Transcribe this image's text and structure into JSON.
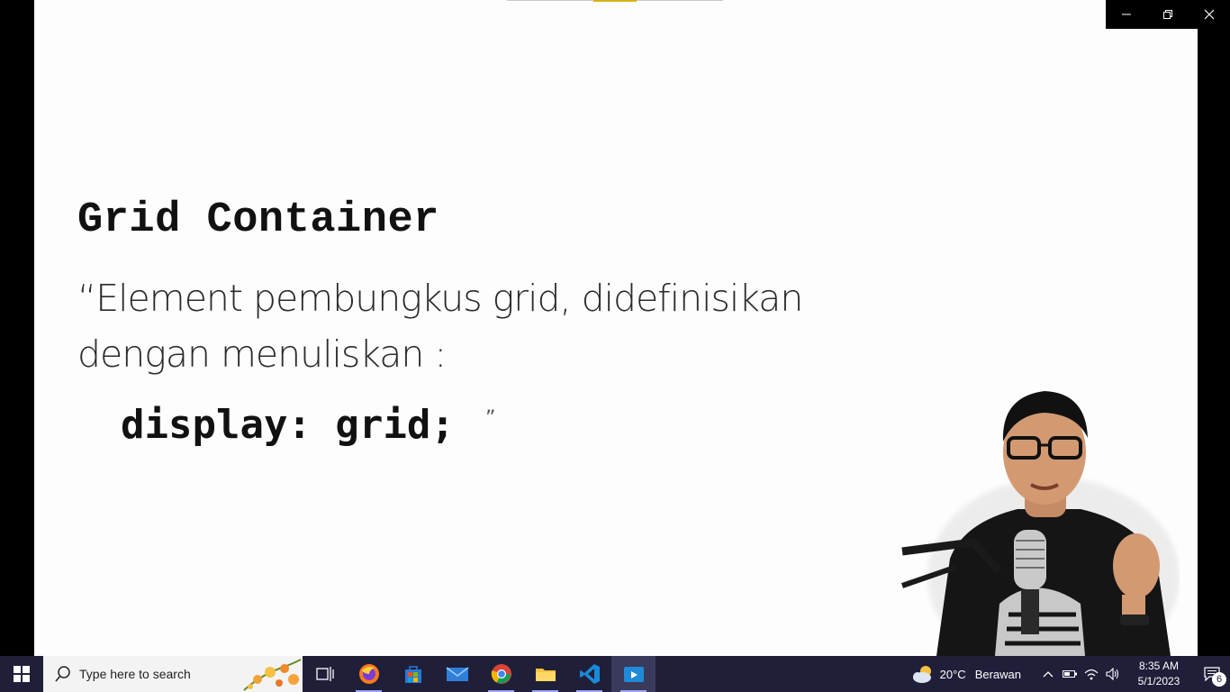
{
  "slide": {
    "title": "Grid Container",
    "quote_line1": "“Element pembungkus grid, didefinisikan",
    "quote_line2": "dengan menuliskan :",
    "code": "display: grid;",
    "close_quote": "”"
  },
  "taskbar": {
    "search_placeholder": "Type here to search",
    "apps": [
      "windows-icon",
      "task-view-icon",
      "firefox-icon",
      "microsoft-store-icon",
      "mail-icon",
      "chrome-icon",
      "file-explorer-icon",
      "vscode-icon",
      "video-player-icon"
    ],
    "weather": {
      "temp": "20°C",
      "condition": "Berawan"
    },
    "clock": {
      "time": "8:35 AM",
      "date": "5/1/2023"
    },
    "notification_count": "6"
  },
  "colors": {
    "taskbar": "#1f1f3a",
    "accent": "#d9b21a"
  }
}
